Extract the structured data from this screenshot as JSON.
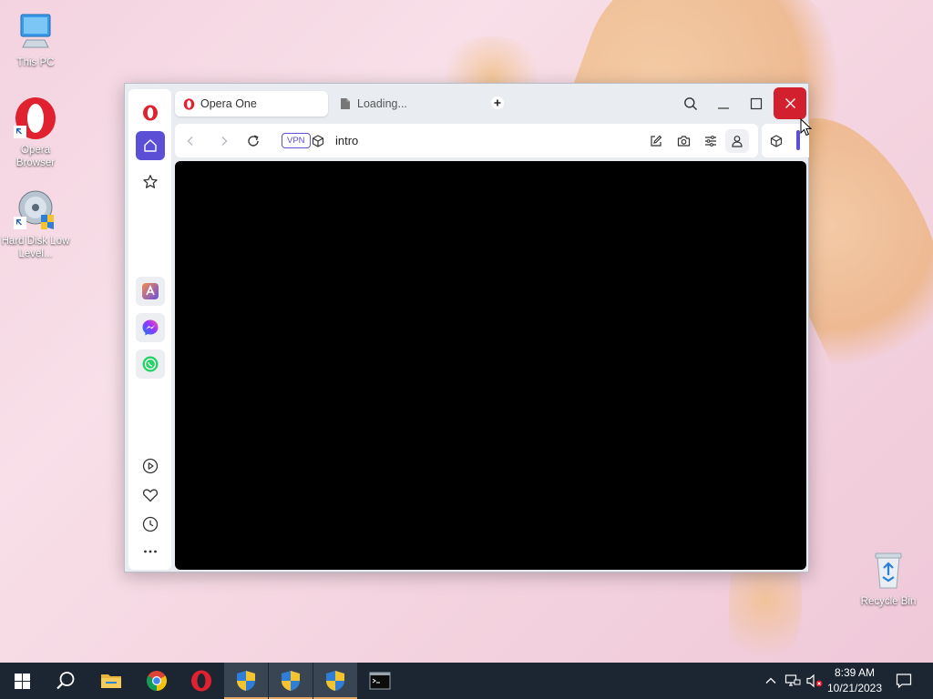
{
  "desktop": {
    "icons": [
      {
        "label": "This PC"
      },
      {
        "label": "Opera Browser"
      },
      {
        "label": "Hard Disk Low Level..."
      },
      {
        "label": "Recycle Bin"
      }
    ]
  },
  "browser": {
    "tabs": [
      {
        "label": "Opera One",
        "active": true,
        "icon": "opera-logo-icon"
      },
      {
        "label": "Loading...",
        "active": false,
        "icon": "page-icon"
      }
    ],
    "address": {
      "vpn_label": "VPN",
      "url": "intro"
    },
    "colors": {
      "accent": "#5b4fd6",
      "close_button": "#d2202f",
      "opera_red": "#e0212f"
    }
  },
  "taskbar": {
    "time": "8:39 AM",
    "date": "10/21/2023"
  }
}
